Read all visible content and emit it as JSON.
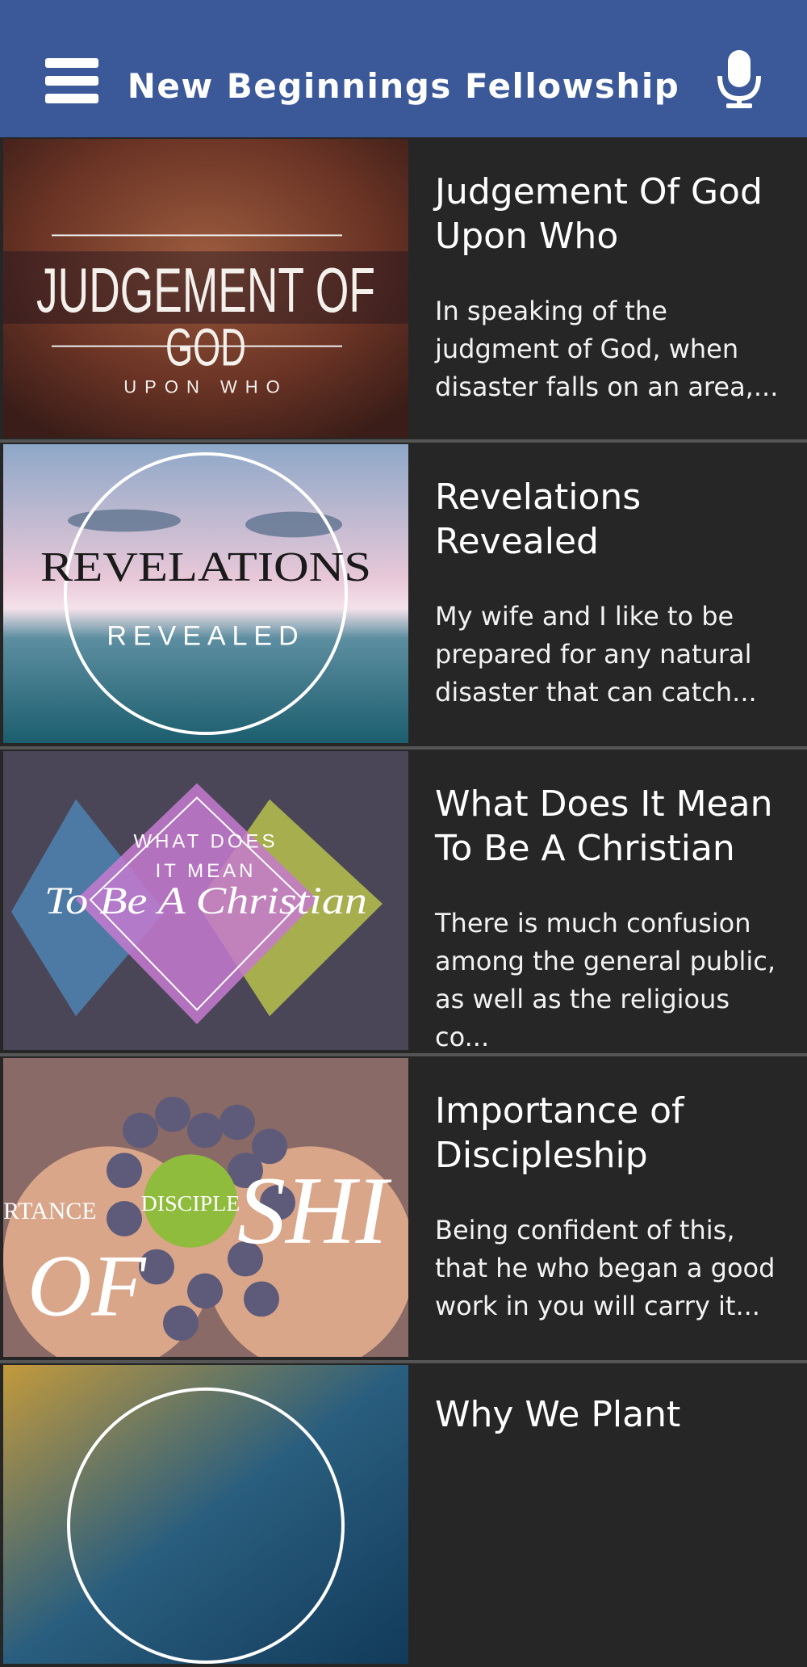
{
  "header": {
    "title": "New Beginnings Fellowship",
    "menu_icon": "hamburger-menu-icon",
    "mic_icon": "microphone-icon",
    "bg_color": "#3b5998"
  },
  "sermons": [
    {
      "title": "Judgement Of God Upon Who",
      "description": "In speaking of the judgment of God, when disaster falls on an area,...",
      "art": {
        "line1": "JUDGEMENT OF",
        "line2": "GOD",
        "line3": "UPON WHO"
      }
    },
    {
      "title": "Revelations Revealed",
      "description": "My wife and I like to be prepared for any natural disaster that can catch...",
      "art": {
        "line1": "REVELATIONS",
        "line2": "REVEALED"
      }
    },
    {
      "title": "What Does It Mean To Be A Christian",
      "description": "There is much confusion among the general public, as well as the religious co...",
      "art": {
        "line1": "WHAT DOES",
        "line2": "IT MEAN",
        "line3": "To Be A Christian"
      }
    },
    {
      "title": "Importance of Discipleship",
      "description": "Being confident of this, that he who began a good work in you will carry it...",
      "art": {
        "line1": "RTANCE",
        "line2": "DISCIPLE",
        "line3": "OF",
        "line4": "SHI"
      }
    },
    {
      "title": "Why We Plant",
      "description": ""
    }
  ]
}
